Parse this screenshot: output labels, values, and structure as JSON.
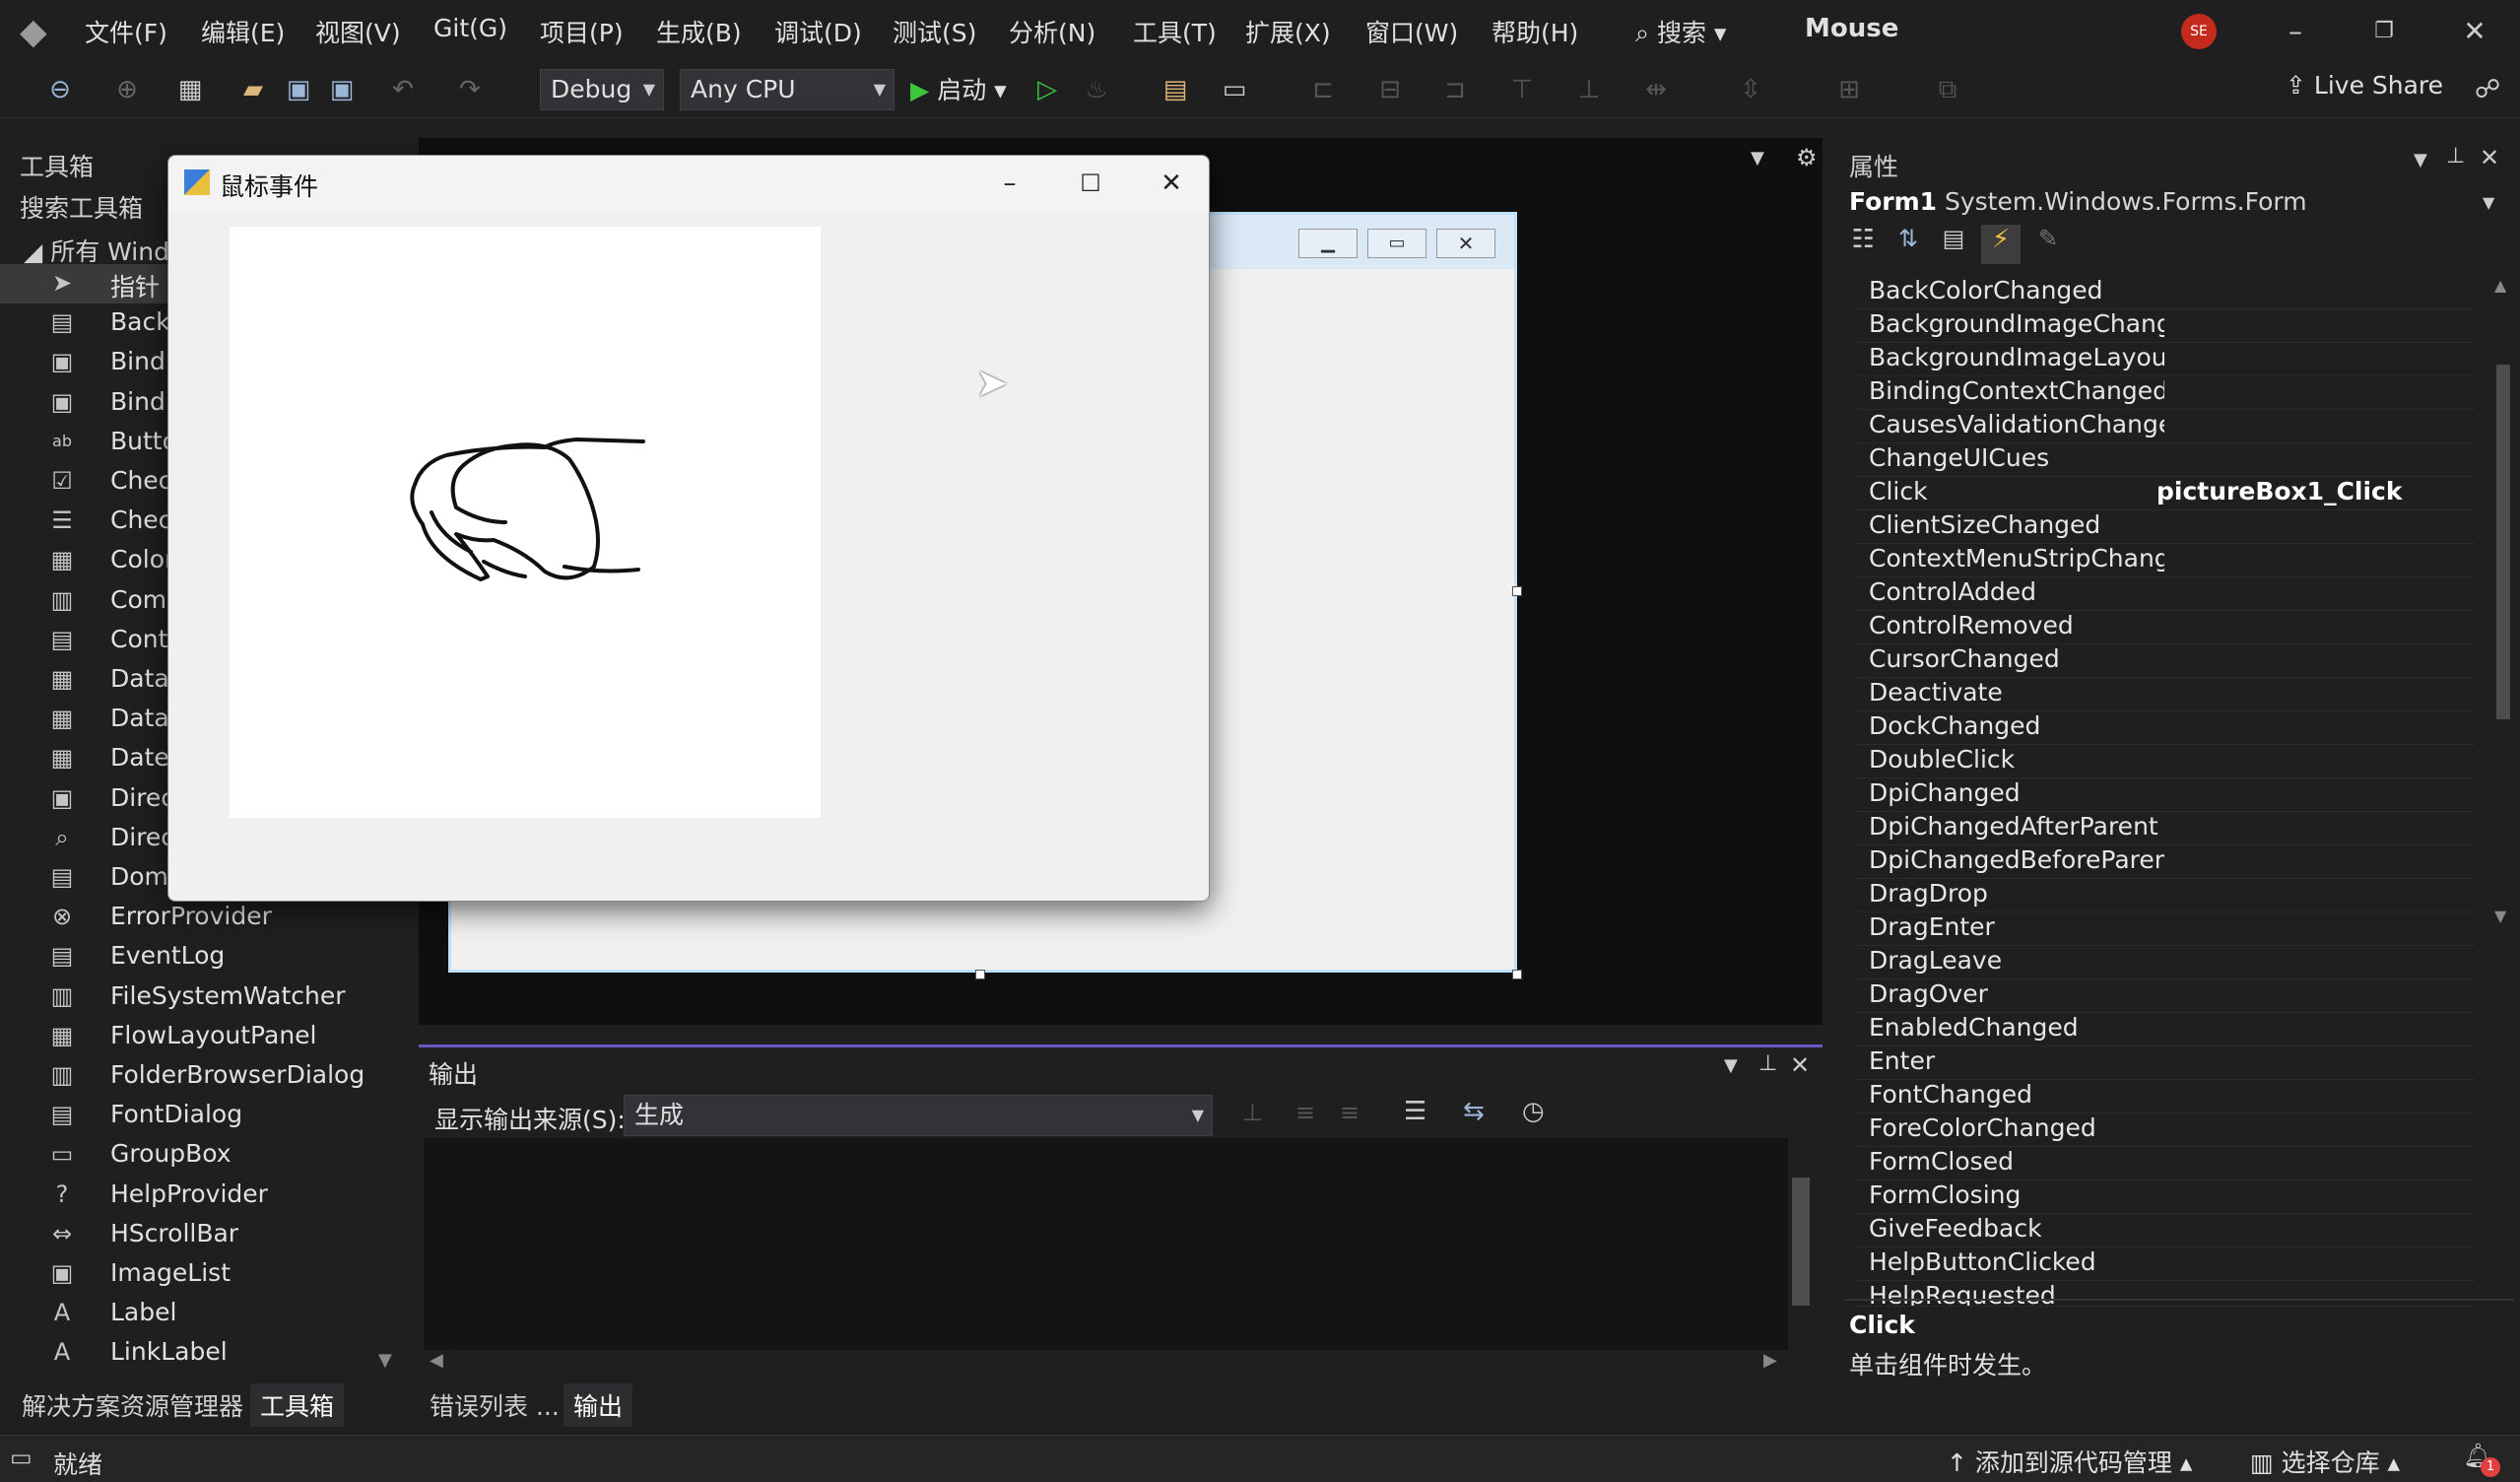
{
  "menu": [
    "文件(F)",
    "编辑(E)",
    "视图(V)",
    "Git(G)",
    "项目(P)",
    "生成(B)",
    "调试(D)",
    "测试(S)",
    "分析(N)",
    "工具(T)",
    "扩展(X)",
    "窗口(W)",
    "帮助(H)"
  ],
  "search_label": "搜索",
  "solution_name": "Mouse",
  "avatar_initials": "SE",
  "toolbar": {
    "config": "Debug",
    "platform": "Any CPU",
    "start_label": "启动",
    "live_share": "Live Share"
  },
  "toolbox": {
    "title": "工具箱",
    "search_placeholder": "搜索工具箱",
    "group": "所有 Windo",
    "items": [
      "指针",
      "Backc",
      "Bindi",
      "Bindi",
      "Butto",
      "Chec",
      "Chec",
      "Color",
      "Comb",
      "Conte",
      "DataC",
      "DataS",
      "DateT",
      "Direc",
      "Direc",
      "Doma",
      "ErrorProvider",
      "EventLog",
      "FileSystemWatcher",
      "FlowLayoutPanel",
      "FolderBrowserDialog",
      "FontDialog",
      "GroupBox",
      "HelpProvider",
      "HScrollBar",
      "ImageList",
      "Label",
      "LinkLabel"
    ]
  },
  "run_window": {
    "title": "鼠标事件"
  },
  "output": {
    "title": "输出",
    "source_label": "显示输出来源(S):",
    "source_value": "生成"
  },
  "bottom_tabs": {
    "left": [
      "解决方案资源管理器",
      "工具箱"
    ],
    "middle": [
      "错误列表 ...",
      "输出"
    ]
  },
  "properties": {
    "title": "属性",
    "object_name": "Form1",
    "object_type": "System.Windows.Forms.Form",
    "events": [
      {
        "name": "BackColorChanged",
        "value": ""
      },
      {
        "name": "BackgroundImageChange",
        "value": ""
      },
      {
        "name": "BackgroundImageLayout",
        "value": ""
      },
      {
        "name": "BindingContextChanged",
        "value": ""
      },
      {
        "name": "CausesValidationChanged",
        "value": ""
      },
      {
        "name": "ChangeUICues",
        "value": ""
      },
      {
        "name": "Click",
        "value": "pictureBox1_Click"
      },
      {
        "name": "ClientSizeChanged",
        "value": ""
      },
      {
        "name": "ContextMenuStripChang",
        "value": ""
      },
      {
        "name": "ControlAdded",
        "value": ""
      },
      {
        "name": "ControlRemoved",
        "value": ""
      },
      {
        "name": "CursorChanged",
        "value": ""
      },
      {
        "name": "Deactivate",
        "value": ""
      },
      {
        "name": "DockChanged",
        "value": ""
      },
      {
        "name": "DoubleClick",
        "value": ""
      },
      {
        "name": "DpiChanged",
        "value": ""
      },
      {
        "name": "DpiChangedAfterParent",
        "value": ""
      },
      {
        "name": "DpiChangedBeforeParent",
        "value": ""
      },
      {
        "name": "DragDrop",
        "value": ""
      },
      {
        "name": "DragEnter",
        "value": ""
      },
      {
        "name": "DragLeave",
        "value": ""
      },
      {
        "name": "DragOver",
        "value": ""
      },
      {
        "name": "EnabledChanged",
        "value": ""
      },
      {
        "name": "Enter",
        "value": ""
      },
      {
        "name": "FontChanged",
        "value": ""
      },
      {
        "name": "ForeColorChanged",
        "value": ""
      },
      {
        "name": "FormClosed",
        "value": ""
      },
      {
        "name": "FormClosing",
        "value": ""
      },
      {
        "name": "GiveFeedback",
        "value": ""
      },
      {
        "name": "HelpButtonClicked",
        "value": ""
      },
      {
        "name": "HelpRequested",
        "value": ""
      }
    ],
    "desc_title": "Click",
    "desc_text": "单击组件时发生。"
  },
  "status": {
    "ready": "就绪",
    "add_source": "添加到源代码管理",
    "select_repo": "选择仓库",
    "notifications": "1"
  },
  "colors": {
    "accent": "#6b56bf",
    "start_green": "#3cc63c"
  }
}
